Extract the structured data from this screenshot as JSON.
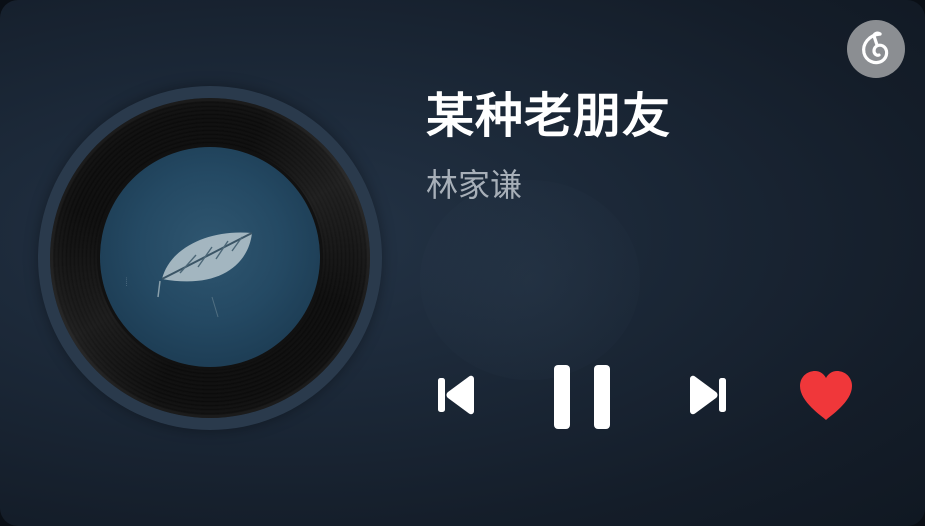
{
  "song": {
    "title": "某种老朋友",
    "artist": "林家谦"
  },
  "controls": {
    "previous": "previous-track",
    "play_state": "playing",
    "next": "next-track",
    "liked": true
  },
  "icons": {
    "app": "netease-music-logo-icon",
    "prev": "skip-previous-icon",
    "pause": "pause-icon",
    "next": "skip-next-icon",
    "like": "heart-icon"
  },
  "colors": {
    "background": "#1a2635",
    "title": "#ffffff",
    "artist": "#a7afb8",
    "heart": "#f0373a",
    "controls": "#ffffff",
    "album_art": "#244963"
  }
}
